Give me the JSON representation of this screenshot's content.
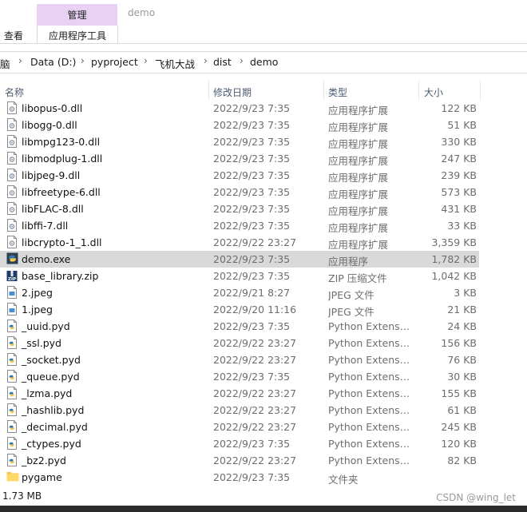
{
  "ribbon": {
    "context_tab_group": "管理",
    "window_title": "demo",
    "tab_view": "查看",
    "tab_app_tools": "应用程序工具"
  },
  "address": {
    "crumbs": [
      "脑",
      "Data (D:)",
      "pyproject",
      "飞机大战",
      "dist",
      "demo"
    ]
  },
  "columns": {
    "name": "名称",
    "date": "修改日期",
    "type": "类型",
    "size": "大小"
  },
  "files": [
    {
      "name": "libopus-0.dll",
      "date": "2022/9/23 7:35",
      "type": "应用程序扩展",
      "size": "122 KB",
      "icon": "dll-file-icon",
      "selected": false
    },
    {
      "name": "libogg-0.dll",
      "date": "2022/9/23 7:35",
      "type": "应用程序扩展",
      "size": "51 KB",
      "icon": "dll-file-icon",
      "selected": false
    },
    {
      "name": "libmpg123-0.dll",
      "date": "2022/9/23 7:35",
      "type": "应用程序扩展",
      "size": "330 KB",
      "icon": "dll-file-icon",
      "selected": false
    },
    {
      "name": "libmodplug-1.dll",
      "date": "2022/9/23 7:35",
      "type": "应用程序扩展",
      "size": "247 KB",
      "icon": "dll-file-icon",
      "selected": false
    },
    {
      "name": "libjpeg-9.dll",
      "date": "2022/9/23 7:35",
      "type": "应用程序扩展",
      "size": "239 KB",
      "icon": "dll-file-icon",
      "selected": false
    },
    {
      "name": "libfreetype-6.dll",
      "date": "2022/9/23 7:35",
      "type": "应用程序扩展",
      "size": "573 KB",
      "icon": "dll-file-icon",
      "selected": false
    },
    {
      "name": "libFLAC-8.dll",
      "date": "2022/9/23 7:35",
      "type": "应用程序扩展",
      "size": "431 KB",
      "icon": "dll-file-icon",
      "selected": false
    },
    {
      "name": "libffi-7.dll",
      "date": "2022/9/23 7:35",
      "type": "应用程序扩展",
      "size": "33 KB",
      "icon": "dll-file-icon",
      "selected": false
    },
    {
      "name": "libcrypto-1_1.dll",
      "date": "2022/9/22 23:27",
      "type": "应用程序扩展",
      "size": "3,359 KB",
      "icon": "dll-file-icon",
      "selected": false
    },
    {
      "name": "demo.exe",
      "date": "2022/9/23 7:35",
      "type": "应用程序",
      "size": "1,782 KB",
      "icon": "python-exe-icon",
      "selected": true
    },
    {
      "name": "base_library.zip",
      "date": "2022/9/23 7:35",
      "type": "ZIP 压缩文件",
      "size": "1,042 KB",
      "icon": "zip-file-icon",
      "selected": false
    },
    {
      "name": "2.jpeg",
      "date": "2022/9/21 8:27",
      "type": "JPEG 文件",
      "size": "3 KB",
      "icon": "image-file-icon",
      "selected": false
    },
    {
      "name": "1.jpeg",
      "date": "2022/9/20 11:16",
      "type": "JPEG 文件",
      "size": "21 KB",
      "icon": "image-file-icon",
      "selected": false
    },
    {
      "name": "_uuid.pyd",
      "date": "2022/9/23 7:35",
      "type": "Python Extension Module",
      "size": "24 KB",
      "icon": "python-file-icon",
      "selected": false
    },
    {
      "name": "_ssl.pyd",
      "date": "2022/9/22 23:27",
      "type": "Python Extension Module",
      "size": "156 KB",
      "icon": "python-file-icon",
      "selected": false
    },
    {
      "name": "_socket.pyd",
      "date": "2022/9/22 23:27",
      "type": "Python Extension Module",
      "size": "76 KB",
      "icon": "python-file-icon",
      "selected": false
    },
    {
      "name": "_queue.pyd",
      "date": "2022/9/23 7:35",
      "type": "Python Extension Module",
      "size": "30 KB",
      "icon": "python-file-icon",
      "selected": false
    },
    {
      "name": "_lzma.pyd",
      "date": "2022/9/22 23:27",
      "type": "Python Extension Module",
      "size": "155 KB",
      "icon": "python-file-icon",
      "selected": false
    },
    {
      "name": "_hashlib.pyd",
      "date": "2022/9/22 23:27",
      "type": "Python Extension Module",
      "size": "61 KB",
      "icon": "python-file-icon",
      "selected": false
    },
    {
      "name": "_decimal.pyd",
      "date": "2022/9/22 23:27",
      "type": "Python Extension Module",
      "size": "245 KB",
      "icon": "python-file-icon",
      "selected": false
    },
    {
      "name": "_ctypes.pyd",
      "date": "2022/9/23 7:35",
      "type": "Python Extension Module",
      "size": "120 KB",
      "icon": "python-file-icon",
      "selected": false
    },
    {
      "name": "_bz2.pyd",
      "date": "2022/9/22 23:27",
      "type": "Python Extension Module",
      "size": "82 KB",
      "icon": "python-file-icon",
      "selected": false
    },
    {
      "name": "pygame",
      "date": "2022/9/23 7:35",
      "type": "文件夹",
      "size": "",
      "icon": "folder-icon",
      "selected": false
    }
  ],
  "status": {
    "selection_size": "1.73 MB",
    "watermark": "CSDN @wing_let"
  },
  "colors": {
    "context_tab": "#e8d1f2",
    "selected_row": "#d9d9d9",
    "header_text": "#4a5a70"
  }
}
